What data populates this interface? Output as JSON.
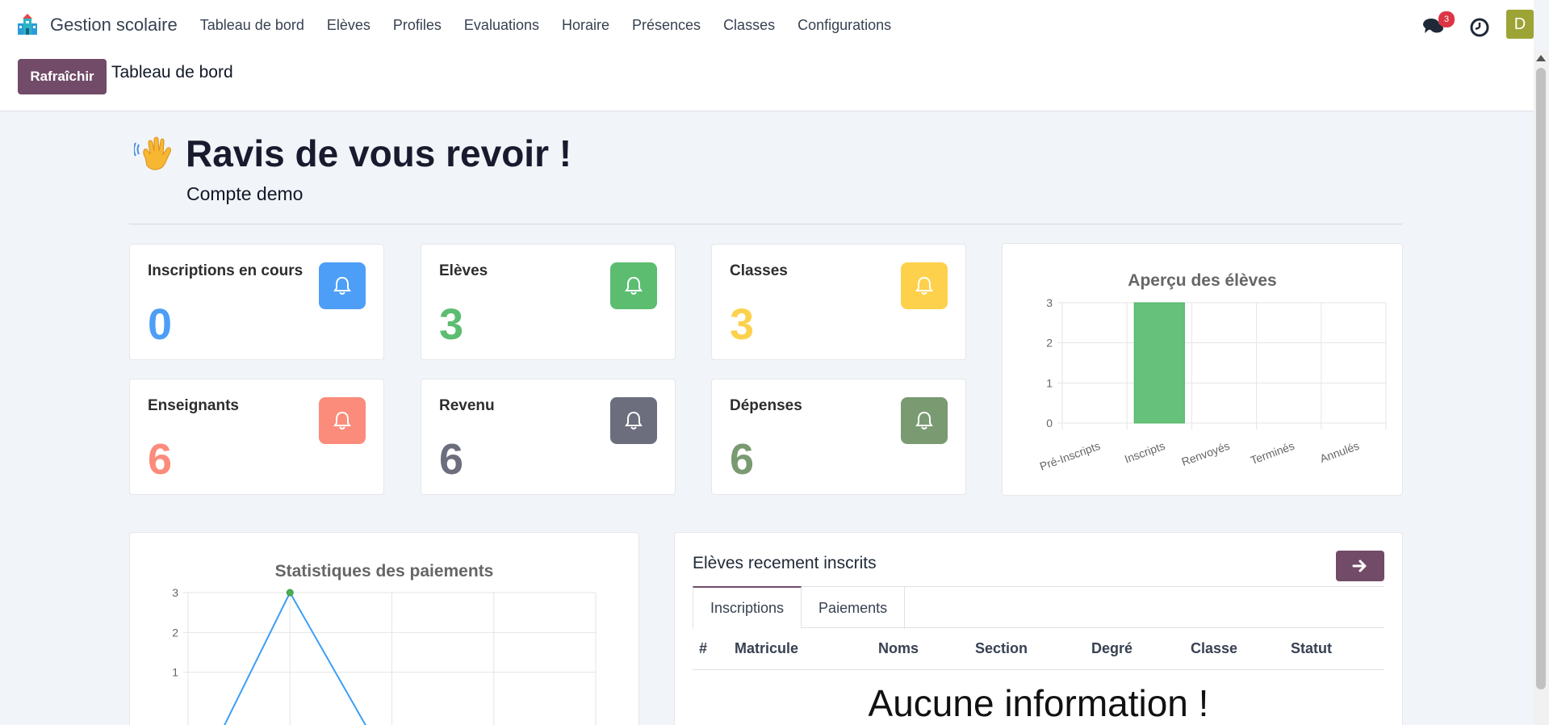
{
  "app": {
    "brand": "Gestion scolaire"
  },
  "nav": {
    "items": [
      "Tableau de bord",
      "Elèves",
      "Profiles",
      "Evaluations",
      "Horaire",
      "Présences",
      "Classes",
      "Configurations"
    ],
    "chat_count": "3",
    "avatar_initial": "D"
  },
  "control": {
    "refresh_label": "Rafraîchir",
    "breadcrumb": "Tableau de bord"
  },
  "greeting": {
    "title": "Ravis de vous revoir !",
    "subtitle": "Compte demo"
  },
  "stats": [
    {
      "label": "Inscriptions en cours",
      "value": "0",
      "color": "#4d9ef6"
    },
    {
      "label": "Elèves",
      "value": "3",
      "color": "#5cbd71"
    },
    {
      "label": "Classes",
      "value": "3",
      "color": "#fdd14c"
    },
    {
      "label": "Enseignants",
      "value": "6",
      "color": "#fb8c7c"
    },
    {
      "label": "Revenu",
      "value": "6",
      "color": "#6c6d7d"
    },
    {
      "label": "Dépenses",
      "value": "6",
      "color": "#7a9a72"
    }
  ],
  "recent": {
    "title": "Elèves recement inscrits",
    "tabs": [
      "Inscriptions",
      "Paiements"
    ],
    "columns": [
      "#",
      "Matricule",
      "Noms",
      "Section",
      "Degré",
      "Classe",
      "Statut"
    ],
    "empty": "Aucune information !"
  },
  "chart_data": [
    {
      "type": "bar",
      "title": "Aperçu des élèves",
      "categories": [
        "Pré-Inscripts",
        "Inscripts",
        "Renvoyés",
        "Terminés",
        "Annulés"
      ],
      "values": [
        0,
        3,
        0,
        0,
        0
      ],
      "ylim": [
        0,
        3
      ],
      "yticks": [
        0,
        1,
        2,
        3
      ],
      "grid": true,
      "color": "#66c27b"
    },
    {
      "type": "line",
      "title": "Statistiques des paiements",
      "x_count": 5,
      "visible_values": [
        null,
        3,
        null,
        null,
        null
      ],
      "ylim": [
        0,
        3
      ],
      "yticks": [
        1,
        2,
        3
      ],
      "grid": true,
      "color": "#3c9ef5"
    }
  ]
}
